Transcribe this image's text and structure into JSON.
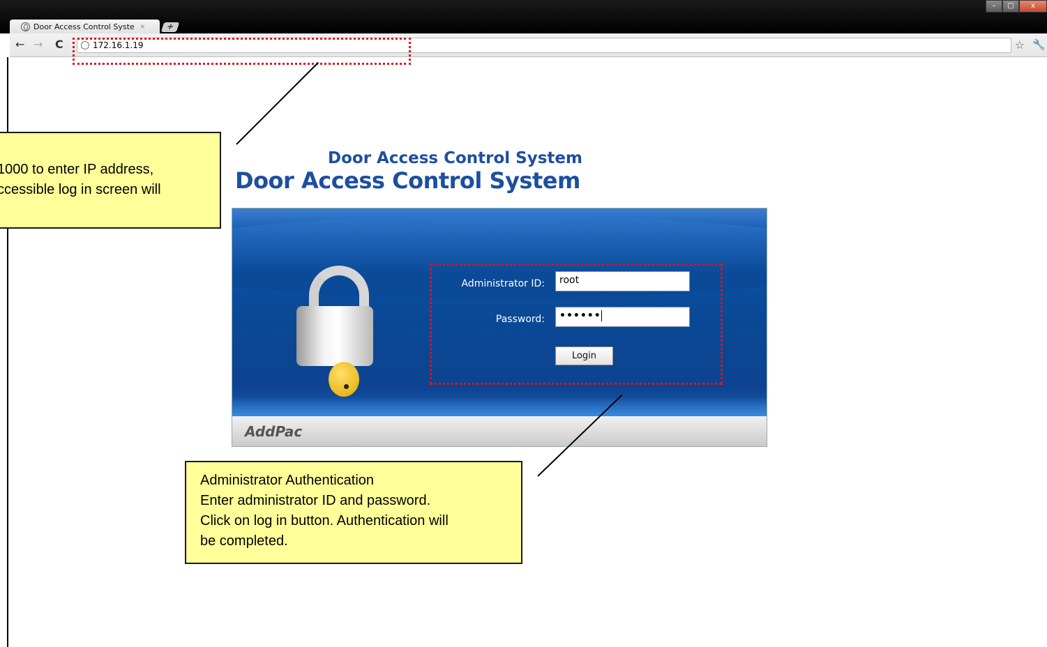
{
  "browser": {
    "tab_title": "Door Access Control Syste",
    "tab_close": "×",
    "new_tab": "+",
    "url": "172.16.1.19",
    "window_controls": {
      "minimize": "–",
      "maximize": "□",
      "close": "x"
    }
  },
  "app": {
    "title_small": "Door Access Control System",
    "title_big": "Door Access Control System",
    "brand": "AddPac",
    "form": {
      "id_label": "Administrator ID:",
      "id_value": "root",
      "password_label": "Password:",
      "password_value": "••••••",
      "login_label": "Login"
    }
  },
  "annotations": {
    "ip_callout_line1": "1000 to enter IP address,",
    "ip_callout_line2": "ccessible log in screen will",
    "auth_callout_title": "Administrator Authentication",
    "auth_callout_line1": "Enter administrator ID and password.",
    "auth_callout_line2": "Click on log in button. Authentication will",
    "auth_callout_line3": "be completed.",
    "highlight_color": "#e0141a",
    "callout_color": "#ffff99"
  },
  "colors": {
    "title_blue": "#1d4fa0",
    "panel_blue": "#0a4996"
  },
  "icons": [
    "globe-icon",
    "back-arrow-icon",
    "forward-arrow-icon",
    "reload-icon",
    "star-icon",
    "wrench-icon",
    "padlock-icon",
    "key-icon"
  ]
}
